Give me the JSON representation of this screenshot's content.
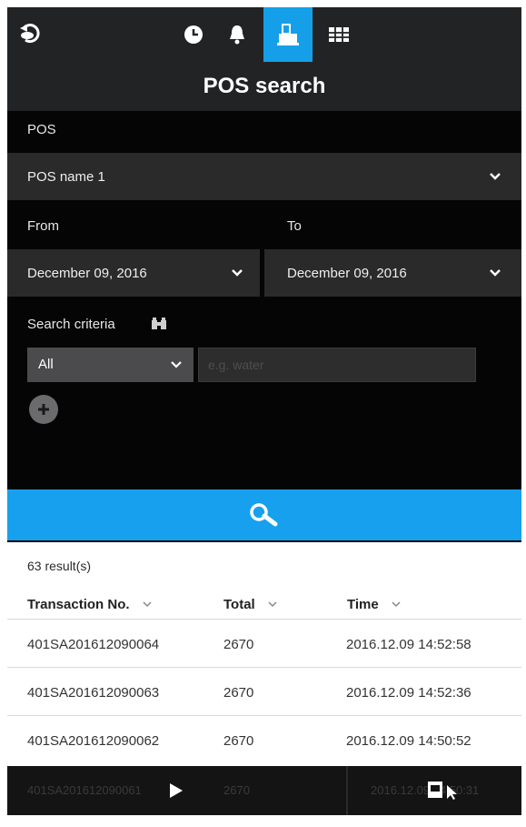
{
  "header": {
    "title": "POS search",
    "tabs": [
      {
        "icon": "clock-icon",
        "active": false
      },
      {
        "icon": "bell-icon",
        "active": false
      },
      {
        "icon": "pos-register-icon",
        "active": true
      },
      {
        "icon": "grid-icon",
        "active": false
      }
    ]
  },
  "form": {
    "pos_label": "POS",
    "pos_value": "POS name 1",
    "from_label": "From",
    "to_label": "To",
    "from_value": "December 09, 2016",
    "to_value": "December 09, 2016",
    "criteria_label": "Search criteria",
    "criteria_select": "All",
    "criteria_placeholder": "e.g. water"
  },
  "results": {
    "count": "63 result(s)",
    "columns": [
      "Transaction No.",
      "Total",
      "Time"
    ],
    "rows": [
      {
        "transaction": "401SA201612090064",
        "total": "2670",
        "time": "2016.12.09 14:52:58"
      },
      {
        "transaction": "401SA201612090063",
        "total": "2670",
        "time": "2016.12.09 14:52:36"
      },
      {
        "transaction": "401SA201612090062",
        "total": "2670",
        "time": "2016.12.09 14:50:52"
      }
    ],
    "partial_row": {
      "transaction": "401SA201612090061",
      "total": "2670",
      "time": "2016.12.09 14:50:31"
    }
  },
  "colors": {
    "accent": "#16a0ee",
    "panel": "#050505",
    "field": "#2a2a2b"
  }
}
